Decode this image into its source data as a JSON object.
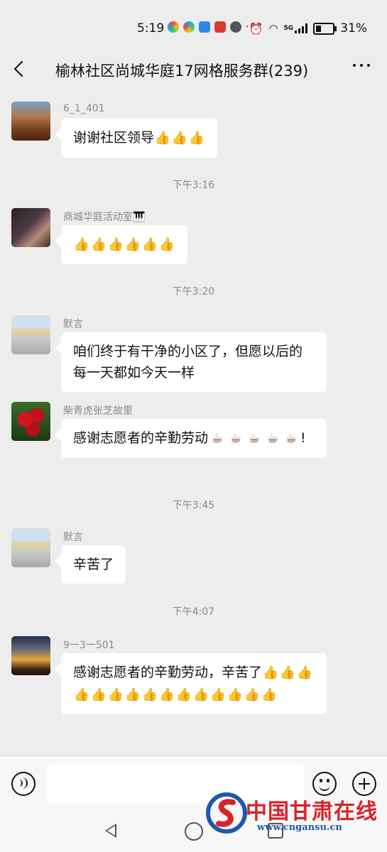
{
  "status_bar": {
    "time": "5:19",
    "network": "5G",
    "battery": "31%",
    "battery_level": 0.31,
    "app_icons": [
      "color-icon",
      "color-icon",
      "cloud-icon",
      "h-icon",
      "message-icon",
      "dots-icon"
    ]
  },
  "header": {
    "title": "榆林社区尚城华庭17网格服务群(239)"
  },
  "messages": [
    {
      "sender": "6_1_401",
      "text": "谢谢社区领导",
      "emoji": "👍👍👍"
    },
    {
      "time": "下午3:16"
    },
    {
      "sender": "商城华庭活动室🎹",
      "text": "",
      "emoji": "👍👍👍👍👍👍"
    },
    {
      "time": "下午3:20"
    },
    {
      "sender": "默言",
      "text": "咱们终于有干净的小区了，但愿以后的每一天都如今天一样"
    },
    {
      "sender": "柴青虎张芝故里",
      "text": "感谢志愿者的辛勤劳动",
      "emoji": "☕☕☕☕☕",
      "suffix": "!"
    },
    {
      "time": "下午3:45"
    },
    {
      "sender": "默言",
      "text": "辛苦了"
    },
    {
      "time": "下午4:07"
    },
    {
      "sender": "9一3一501",
      "text": "感谢志愿者的辛勤劳动，辛苦了",
      "emoji": "👍👍👍👍👍👍👍👍👍👍👍👍👍👍👍"
    }
  ],
  "watermark": {
    "name": "中国甘肃在线",
    "url": "www.cngansu.cn"
  },
  "colors": {
    "background": "#ededed",
    "bubble": "#ffffff",
    "meta_text": "#8a8a8a",
    "watermark_red": "#d8232a",
    "watermark_blue": "#1e59b0"
  }
}
